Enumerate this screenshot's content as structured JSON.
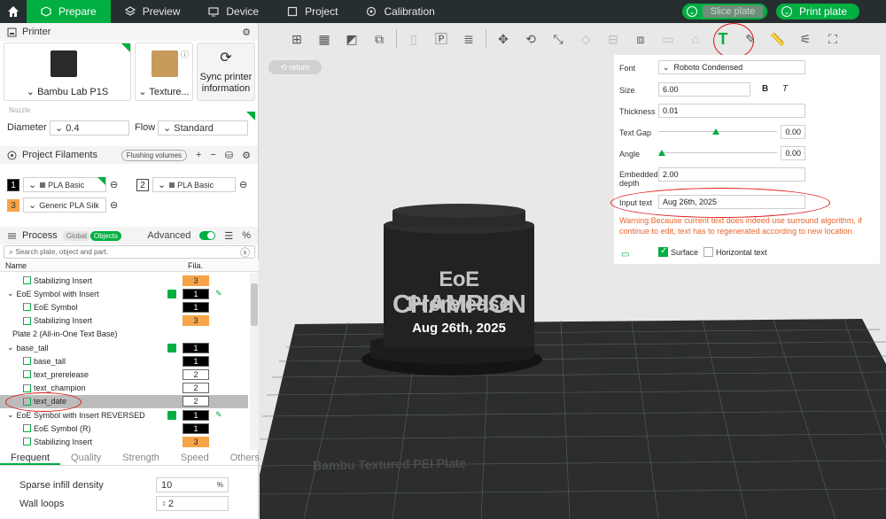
{
  "topbar": {
    "tabs": [
      {
        "label": "Prepare",
        "icon": "cube-icon",
        "active": true
      },
      {
        "label": "Preview",
        "icon": "layers-icon"
      },
      {
        "label": "Device",
        "icon": "device-icon"
      },
      {
        "label": "Project",
        "icon": "project-icon"
      },
      {
        "label": "Calibration",
        "icon": "calibration-icon"
      }
    ],
    "slice_label": "Slice plate",
    "print_label": "Print plate"
  },
  "printer": {
    "section_title": "Printer",
    "printer_name": "Bambu Lab P1S",
    "plate_name": "Texture...",
    "sync_label": "Sync printer information",
    "nozzle_label": "Nozzle",
    "diameter_label": "Diameter",
    "diameter_value": "0.4",
    "flow_label": "Flow",
    "flow_value": "Standard"
  },
  "filaments": {
    "section_title": "Project Filaments",
    "flushing_label": "Flushing volumes",
    "items": [
      {
        "slot": "1",
        "name": "PLA Basic",
        "color": "#000000"
      },
      {
        "slot": "2",
        "name": "PLA Basic",
        "color": "#ffffff"
      },
      {
        "slot": "3",
        "name": "Generic PLA Silk",
        "color": "#f7a447"
      }
    ]
  },
  "process": {
    "section_title": "Process",
    "global_label": "Global",
    "objects_label": "Objects",
    "advanced_label": "Advanced",
    "search_placeholder": "Search plate, object and part.",
    "col_name": "Name",
    "col_fila": "Fila.",
    "tree": [
      {
        "name": "Stabilizing Insert",
        "indent": 2,
        "fila": "3",
        "fila_color": "orange"
      },
      {
        "name": "EoE Symbol with Insert",
        "indent": 1,
        "fila": "1",
        "fila_color": "black",
        "checked": true,
        "paint": true
      },
      {
        "name": "EoE Symbol",
        "indent": 2,
        "fila": "1",
        "fila_color": "black"
      },
      {
        "name": "Stabilizing Insert",
        "indent": 2,
        "fila": "3",
        "fila_color": "orange"
      },
      {
        "name": "Plate 2 (All-in-One Text Base)",
        "indent": 0
      },
      {
        "name": "base_tall",
        "indent": 1,
        "fila": "1",
        "fila_color": "black",
        "checked": true
      },
      {
        "name": "base_tall",
        "indent": 2,
        "fila": "1",
        "fila_color": "black"
      },
      {
        "name": "text_prerelease",
        "indent": 2,
        "fila": "2",
        "fila_color": "white"
      },
      {
        "name": "text_champion",
        "indent": 2,
        "fila": "2",
        "fila_color": "white"
      },
      {
        "name": "text_date",
        "indent": 2,
        "fila": "2",
        "fila_color": "white",
        "selected": true
      },
      {
        "name": "EoE Symbol with Insert REVERSED",
        "indent": 1,
        "fila": "1",
        "fila_color": "black",
        "checked": true,
        "paint": true
      },
      {
        "name": "EoE Symbol (R)",
        "indent": 2,
        "fila": "1",
        "fila_color": "black"
      },
      {
        "name": "Stabilizing Insert",
        "indent": 2,
        "fila": "3",
        "fila_color": "orange"
      }
    ],
    "tabs": [
      "Frequent",
      "Quality",
      "Strength",
      "Speed",
      "Others"
    ],
    "params": [
      {
        "label": "Sparse infill density",
        "value": "10",
        "unit": "%"
      },
      {
        "label": "Wall loops",
        "value": "2",
        "unit": ""
      }
    ]
  },
  "viewport": {
    "return_label": "return",
    "model_lines": [
      "EoE Prerelease",
      "CHAMPION",
      "Aug 26th, 2025"
    ],
    "plate_label": "Bambu Textured PEI Plate"
  },
  "text_panel": {
    "font_label": "Font",
    "font_value": "Roboto Condensed",
    "size_label": "Size",
    "size_value": "6.00",
    "bold_label": "B",
    "italic_label": "T",
    "thickness_label": "Thickness",
    "thickness_value": "0.01",
    "gap_label": "Text Gap",
    "gap_value": "0.00",
    "angle_label": "Angle",
    "angle_value": "0.00",
    "embedded_label": "Embedded depth",
    "embedded_value": "2.00",
    "input_label": "Input text",
    "input_value": "Aug 26th, 2025",
    "warning": "Warning:Because current text does indeed use surround algorithm, if continue to edit, text has to regenerated according to new location.",
    "surface_label": "Surface",
    "surface_checked": true,
    "horizontal_label": "Horizontal text",
    "horizontal_checked": false
  }
}
